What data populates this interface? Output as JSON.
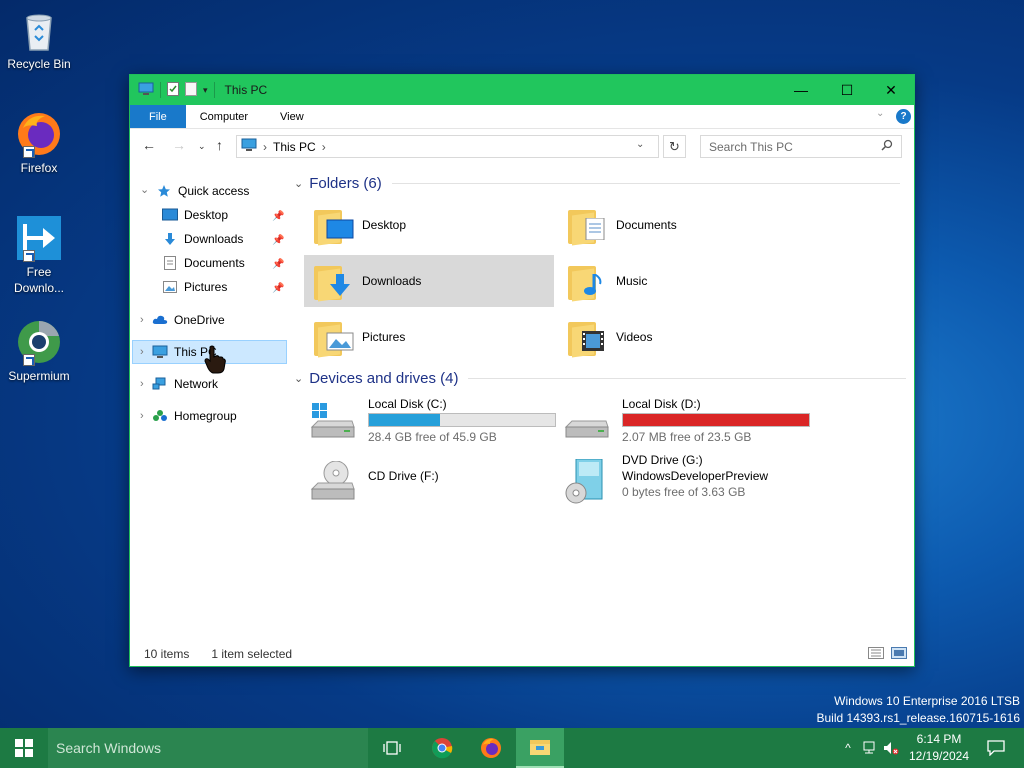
{
  "desktop": {
    "icons": [
      {
        "label": "Recycle Bin",
        "icon": "recycle-bin-icon"
      },
      {
        "label": "Firefox",
        "icon": "firefox-icon"
      },
      {
        "label": "Free Downlo...",
        "icon": "free-download-manager-icon"
      },
      {
        "label": "Supermium",
        "icon": "supermium-icon"
      }
    ],
    "watermark": {
      "line1": "Windows 10 Enterprise 2016 LTSB",
      "line2": "Build 14393.rs1_release.160715-1616"
    }
  },
  "window": {
    "title": "This PC",
    "accent": "#21c65d",
    "controls": {
      "minimize": "—",
      "maximize": "☐",
      "close": "✕"
    },
    "ribbon": {
      "tabs": [
        "File",
        "Computer",
        "View"
      ]
    },
    "address": {
      "path": "This PC",
      "separator": "›"
    },
    "search": {
      "placeholder": "Search This PC"
    },
    "nav": {
      "quick_access": "Quick access",
      "pinned": [
        "Desktop",
        "Downloads",
        "Documents",
        "Pictures"
      ],
      "onedrive": "OneDrive",
      "this_pc": "This PC",
      "network": "Network",
      "homegroup": "Homegroup"
    },
    "folders": {
      "header": "Folders (6)",
      "items": [
        "Desktop",
        "Documents",
        "Downloads",
        "Music",
        "Pictures",
        "Videos"
      ],
      "selected": "Downloads"
    },
    "drives": {
      "header": "Devices and drives (4)",
      "items": [
        {
          "name": "Local Disk (C:)",
          "free": "28.4 GB free of 45.9 GB",
          "used_fraction": 0.38,
          "bar_color": "#26a0da"
        },
        {
          "name": "Local Disk (D:)",
          "free": "2.07 MB free of 23.5 GB",
          "used_fraction": 1.0,
          "bar_color": "#da2626"
        },
        {
          "name": "CD Drive (F:)"
        },
        {
          "name": "DVD Drive (G:)",
          "subtitle": "WindowsDeveloperPreview",
          "free": "0 bytes free of 3.63 GB"
        }
      ]
    },
    "status": {
      "items": "10 items",
      "selection": "1 item selected"
    }
  },
  "taskbar": {
    "search_placeholder": "Search Windows",
    "apps": [
      "task-view-icon",
      "chrome-icon",
      "firefox-icon",
      "file-explorer-icon"
    ],
    "clock": {
      "time": "6:14 PM",
      "date": "12/19/2024"
    }
  }
}
